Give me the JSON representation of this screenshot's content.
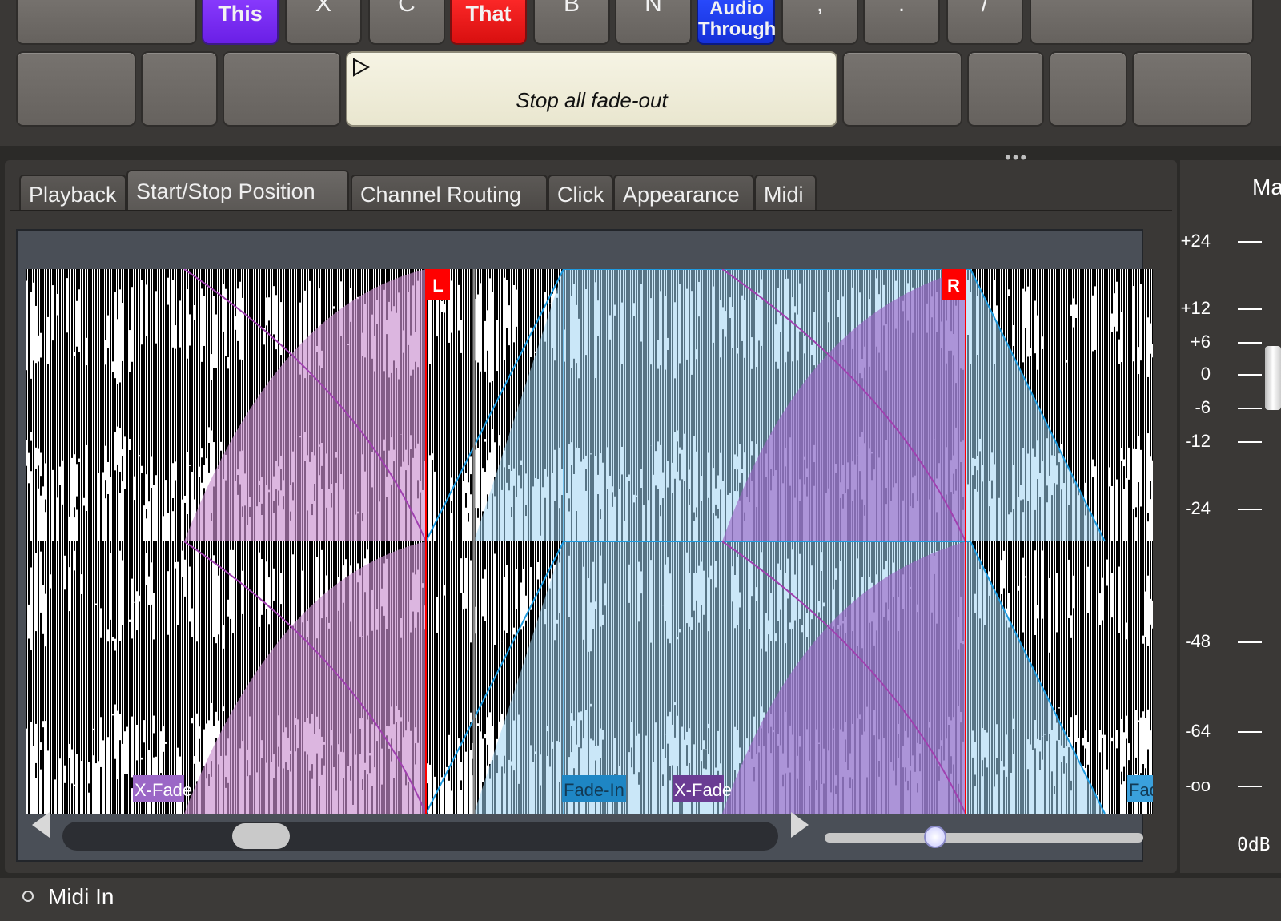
{
  "keys_row1": [
    {
      "label": "",
      "style": "normal"
    },
    {
      "label": "This",
      "style": "purple"
    },
    {
      "label": "X",
      "style": "normal"
    },
    {
      "label": "C",
      "style": "normal"
    },
    {
      "label": "That",
      "style": "red"
    },
    {
      "label": "B",
      "style": "normal"
    },
    {
      "label": "N",
      "style": "normal"
    },
    {
      "label": "Audio Through",
      "style": "blue"
    },
    {
      "label": ",",
      "style": "normal"
    },
    {
      "label": ".",
      "style": "normal"
    },
    {
      "label": "/",
      "style": "normal"
    },
    {
      "label": "",
      "style": "normal"
    }
  ],
  "keys_row2": {
    "big_label": "Stop all fade-out"
  },
  "colors": {
    "purple_key": "#7b2cff",
    "red_key": "#e81515",
    "blue_key": "#1f3bff",
    "xfade_fill": "#c98fd0",
    "fadein_fill": "#9fd4f2",
    "marker_red": "#ff0000"
  },
  "tabs": {
    "playback": "Playback",
    "start_stop": "Start/Stop Position",
    "channel_routing": "Channel Routing",
    "click": "Click",
    "appearance": "Appearance",
    "midi": "Midi"
  },
  "waveform": {
    "marker_left": "L",
    "marker_right": "R",
    "label_xfade_1": "X-Fade",
    "label_fadein": "Fade-In",
    "label_xfade_2": "X-Fade",
    "label_fade_cut": "Fad"
  },
  "meter": {
    "title": "Ma",
    "scale": [
      "+24",
      "+12",
      "+6",
      "0",
      "-6",
      "-12",
      "-24",
      "-48",
      "-64",
      "-oo"
    ],
    "readout": "0dB"
  },
  "status": {
    "midi_in": "Midi In"
  },
  "dots": "•••"
}
